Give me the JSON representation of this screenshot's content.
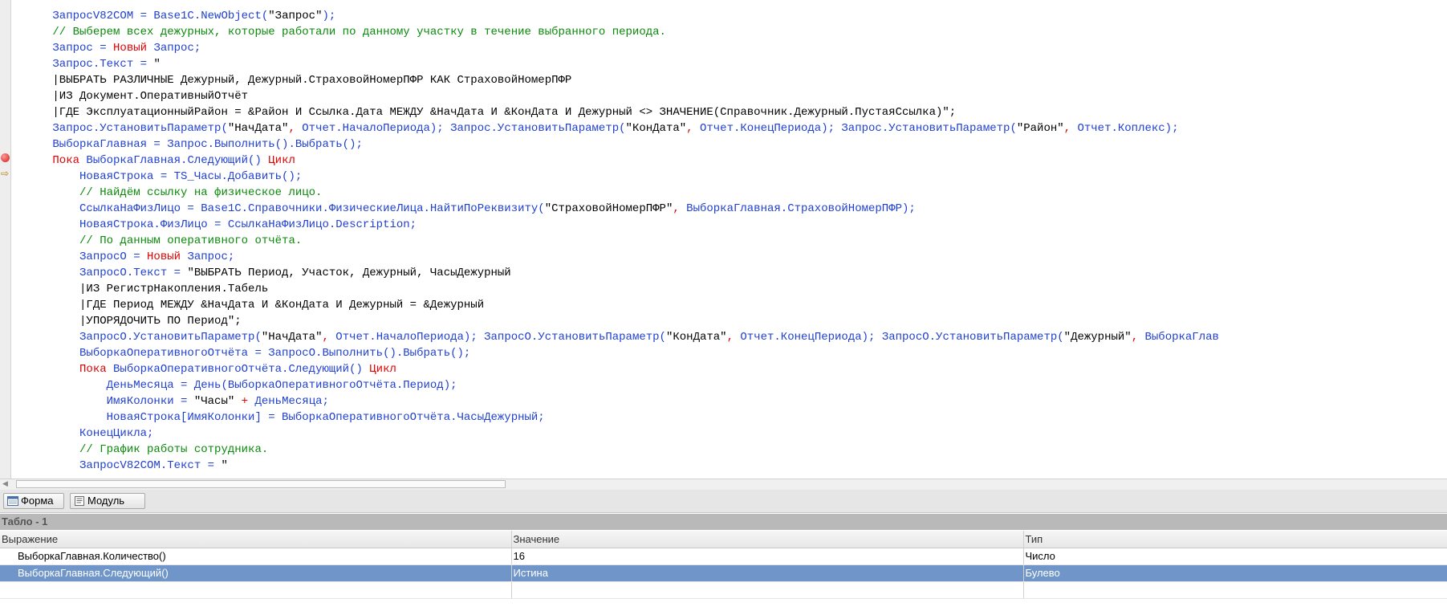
{
  "code": [
    [
      {
        "t": "ident",
        "s": "      ЗапросV82COM = Base1C.NewObject("
      },
      {
        "t": "str",
        "s": "\"Запрос\""
      },
      {
        "t": "ident",
        "s": ");"
      }
    ],
    [
      {
        "t": "cmt",
        "s": "      // Выберем всех дежурных, которые работали по данному участку в течение выбранного периода."
      }
    ],
    [
      {
        "t": "ident",
        "s": "      Запрос = "
      },
      {
        "t": "kw",
        "s": "Новый"
      },
      {
        "t": "ident",
        "s": " Запрос;"
      }
    ],
    [
      {
        "t": "ident",
        "s": "      Запрос.Текст = "
      },
      {
        "t": "str",
        "s": "\""
      }
    ],
    [
      {
        "t": "str",
        "s": "      |ВЫБРАТЬ РАЗЛИЧНЫЕ Дежурный, Дежурный.СтраховойНомерПФР КАК СтраховойНомерПФР"
      }
    ],
    [
      {
        "t": "str",
        "s": "      |ИЗ Документ.ОперативныйОтчёт"
      }
    ],
    [
      {
        "t": "str",
        "s": "      |ГДЕ ЭксплуатационныйРайон = &Район И Ссылка.Дата МЕЖДУ &НачДата И &КонДата И Дежурный <> ЗНАЧЕНИЕ(Справочник.Дежурный.ПустаяСсылка)\";"
      }
    ],
    [
      {
        "t": "ident",
        "s": "      Запрос.УстановитьПараметр("
      },
      {
        "t": "str",
        "s": "\"НачДата\""
      },
      {
        "t": "op",
        "s": ","
      },
      {
        "t": "ident",
        "s": " Отчет.НачалоПериода); Запрос.УстановитьПараметр("
      },
      {
        "t": "str",
        "s": "\"КонДата\""
      },
      {
        "t": "op",
        "s": ","
      },
      {
        "t": "ident",
        "s": " Отчет.КонецПериода); Запрос.УстановитьПараметр("
      },
      {
        "t": "str",
        "s": "\"Район\""
      },
      {
        "t": "op",
        "s": ","
      },
      {
        "t": "ident",
        "s": " Отчет.Коплекс);"
      }
    ],
    [
      {
        "t": "ident",
        "s": "      ВыборкаГлавная = Запрос.Выполнить().Выбрать();"
      }
    ],
    [
      {
        "t": "kw",
        "s": "      Пока"
      },
      {
        "t": "ident",
        "s": " ВыборкаГлавная.Следующий() "
      },
      {
        "t": "kw",
        "s": "Цикл"
      }
    ],
    [
      {
        "t": "ident",
        "s": "          НоваяСтрока = TS_Часы.Добавить();"
      }
    ],
    [
      {
        "t": "cmt",
        "s": "          // Найдём ссылку на физическое лицо."
      }
    ],
    [
      {
        "t": "ident",
        "s": "          СсылкаНаФизЛицо = Base1C.Справочники.ФизическиеЛица.НайтиПоРеквизиту("
      },
      {
        "t": "str",
        "s": "\"СтраховойНомерПФР\""
      },
      {
        "t": "op",
        "s": ","
      },
      {
        "t": "ident",
        "s": " ВыборкаГлавная.СтраховойНомерПФР);"
      }
    ],
    [
      {
        "t": "ident",
        "s": "          НоваяСтрока.ФизЛицо = СсылкаНаФизЛицо.Description;"
      }
    ],
    [
      {
        "t": "cmt",
        "s": "          // По данным оперативного отчёта."
      }
    ],
    [
      {
        "t": "ident",
        "s": "          ЗапросО = "
      },
      {
        "t": "kw",
        "s": "Новый"
      },
      {
        "t": "ident",
        "s": " Запрос;"
      }
    ],
    [
      {
        "t": "ident",
        "s": "          ЗапросО.Текст = "
      },
      {
        "t": "str",
        "s": "\"ВЫБРАТЬ Период, Участок, Дежурный, ЧасыДежурный"
      }
    ],
    [
      {
        "t": "str",
        "s": "          |ИЗ РегистрНакопления.Табель"
      }
    ],
    [
      {
        "t": "str",
        "s": "          |ГДЕ Период МЕЖДУ &НачДата И &КонДата И Дежурный = &Дежурный"
      }
    ],
    [
      {
        "t": "str",
        "s": "          |УПОРЯДОЧИТЬ ПО Период\";"
      }
    ],
    [
      {
        "t": "ident",
        "s": "          ЗапросО.УстановитьПараметр("
      },
      {
        "t": "str",
        "s": "\"НачДата\""
      },
      {
        "t": "op",
        "s": ","
      },
      {
        "t": "ident",
        "s": " Отчет.НачалоПериода); ЗапросО.УстановитьПараметр("
      },
      {
        "t": "str",
        "s": "\"КонДата\""
      },
      {
        "t": "op",
        "s": ","
      },
      {
        "t": "ident",
        "s": " Отчет.КонецПериода); ЗапросО.УстановитьПараметр("
      },
      {
        "t": "str",
        "s": "\"Дежурный\""
      },
      {
        "t": "op",
        "s": ","
      },
      {
        "t": "ident",
        "s": " ВыборкаГлав"
      }
    ],
    [
      {
        "t": "ident",
        "s": "          ВыборкаОперативногоОтчёта = ЗапросО.Выполнить().Выбрать();"
      }
    ],
    [
      {
        "t": "kw",
        "s": "          Пока"
      },
      {
        "t": "ident",
        "s": " ВыборкаОперативногоОтчёта.Следующий() "
      },
      {
        "t": "kw",
        "s": "Цикл"
      }
    ],
    [
      {
        "t": "ident",
        "s": "              ДеньМесяца = День(ВыборкаОперативногоОтчёта.Период);"
      }
    ],
    [
      {
        "t": "ident",
        "s": "              ИмяКолонки = "
      },
      {
        "t": "str",
        "s": "\"Часы\""
      },
      {
        "t": "op",
        "s": " +"
      },
      {
        "t": "ident",
        "s": " ДеньМесяца;"
      }
    ],
    [
      {
        "t": "ident",
        "s": "              НоваяСтрока[ИмяКолонки] = ВыборкаОперативногоОтчёта.ЧасыДежурный;"
      }
    ],
    [
      {
        "t": "ident",
        "s": "          КонецЦикла;"
      }
    ],
    [
      {
        "t": "cmt",
        "s": "          // График работы сотрудника."
      }
    ],
    [
      {
        "t": "ident",
        "s": "          ЗапросV82COM.Текст = "
      },
      {
        "t": "str",
        "s": "\""
      }
    ]
  ],
  "gutter": {
    "breakpoint_icon": "breakpoint-icon",
    "current_line_icon": "arrow-right-icon",
    "current_line_glyph": "⇨"
  },
  "tabs": [
    {
      "label": "Форма",
      "icon": "form-icon"
    },
    {
      "label": "Модуль",
      "icon": "module-icon"
    }
  ],
  "panel": {
    "title": "Табло - 1",
    "columns": [
      "Выражение",
      "Значение",
      "Тип"
    ],
    "rows": [
      {
        "expression": "ВыборкаГлавная.Количество()",
        "value": "16",
        "type": "Число",
        "selected": false
      },
      {
        "expression": "ВыборкаГлавная.Следующий()",
        "value": "Истина",
        "type": "Булево",
        "selected": true
      },
      {
        "expression": "",
        "value": "",
        "type": "",
        "selected": false
      }
    ]
  },
  "colors": {
    "identifier": "#1f3fd1",
    "keyword": "#e00000",
    "comment": "#0a8a0a",
    "string": "#000000",
    "selection": "#7095c8"
  }
}
